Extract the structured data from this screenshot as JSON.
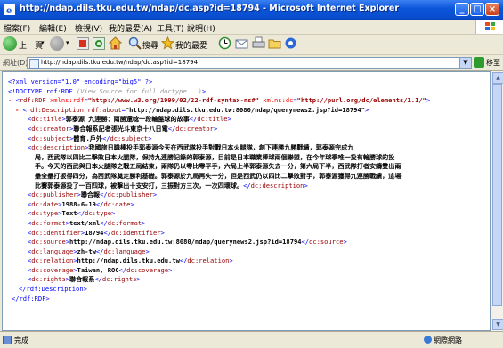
{
  "window": {
    "title": "http://ndap.dils.tku.edu.tw/ndap/dc.asp?id=18794 - Microsoft Internet Explorer"
  },
  "menu": [
    "檔案(F)",
    "編輯(E)",
    "檢視(V)",
    "我的最愛(A)",
    "工具(T)",
    "說明(H)"
  ],
  "toolbar": {
    "back_label": "上一頁",
    "search_label": "搜尋",
    "favorites_label": "我的最愛"
  },
  "address": {
    "label": "網址(D)",
    "url": "http://ndap.dils.tku.edu.tw/ndap/dc.asp?id=18794",
    "go_label": "移至"
  },
  "xml": {
    "decl": "<?xml version=\"1.0\" encoding=\"big5\" ?>",
    "doctype": "<!DOCTYPE rdf:RDF ",
    "doctype_comment": "(View Source for full doctype...)",
    "doctype_end": ">",
    "rdf_open": "rdf:RDF",
    "xmlns_rdf_attr": "xmlns:rdf",
    "xmlns_rdf_val": "\"http://www.w3.org/1999/02/22-rdf-syntax-ns#\"",
    "xmlns_dc_attr": "xmlns:dc",
    "xmlns_dc_val": "\"http://purl.org/dc/elements/1.1/\"",
    "desc_open": "rdf:Description",
    "about_attr": "rdf:about",
    "about_val": "\"http://ndap.dils.tku.edu.tw:8080/ndap/querynews2.jsp?id=18794\"",
    "fields": [
      {
        "tag": "dc:title",
        "value": "郭泰源 九連勝：兩勝還唸一段輪盤球的故事"
      },
      {
        "tag": "dc:creator",
        "value": "聯合報系記者張光斗東京十八日電"
      },
      {
        "tag": "dc:subject",
        "value": "體育.戶外"
      },
      {
        "tag": "dc:publisher",
        "value": "聯合報"
      },
      {
        "tag": "dc:date",
        "value": "1988-6-19"
      },
      {
        "tag": "dc:type",
        "value": "Text"
      },
      {
        "tag": "dc:format",
        "value": "text/xml"
      },
      {
        "tag": "dc:identifier",
        "value": "18794"
      },
      {
        "tag": "dc:source",
        "value": "http://ndap.dils.tku.edu.tw:8080/ndap/querynews2.jsp?id=18794"
      },
      {
        "tag": "dc:language",
        "value": "zh-tw"
      },
      {
        "tag": "dc:relation",
        "value": "http://ndap.dils.tku.edu.tw"
      },
      {
        "tag": "dc:coverage",
        "value": "Taiwan, ROC"
      },
      {
        "tag": "dc:rights",
        "value": "聯合報系"
      }
    ],
    "description_tag": "dc:description",
    "description_lines": [
      "我國旅日職棒投手郭泰源今天在西武隊投手對戰日本火腿隊，創下連勝九勝戰績，郭泰源完成九",
      "局，西武隊以四比二擊敗日本火腿隊，保持九連勝記錄的郭泰源，目前是日本職業棒球兩個聯盟，在今年球季唯一投有輪勝球的投",
      "手。今天的西武與日本火腿隊之戰五局結束，兩隊仍以零比零平手，六局上半郭泰源失去一分，第六局下半，西武隊打者安鑄雙出兩",
      "壘全壘打扳得四分，為西武隊奠定勝利基礎。郭泰源於九局再失一分，但是西武仍以四比二擊敗對手，郭泰源獲得九連勝戰績，這場",
      "比賽郭泰源投了一百四球，被擊出十支安打，三振對方三次，一次四壞球。"
    ],
    "desc_close": "</rdf:Description>",
    "rdf_close": "</rdf:RDF>"
  },
  "status": {
    "left": "完成",
    "zone": "網際網路"
  }
}
